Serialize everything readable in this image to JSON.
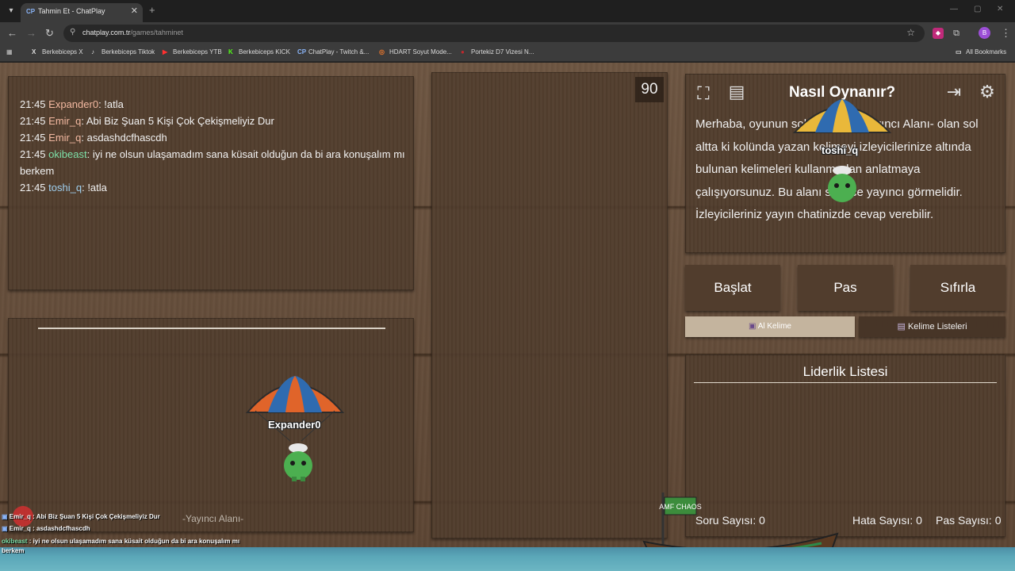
{
  "browser": {
    "tab_title": "Tahmin Et - ChatPlay",
    "tab_favicon": "CP",
    "url_host": "chatplay.com.tr",
    "url_path": "/games/tahminet",
    "profile_initial": "B"
  },
  "bookmarks": [
    {
      "icon": "X",
      "label": "Berkebiceps X",
      "color": "#ffffff"
    },
    {
      "icon": "♪",
      "label": "Berkebiceps Tiktok",
      "color": "#ffffff"
    },
    {
      "icon": "▶",
      "label": "Berkebiceps YTB",
      "color": "#ff3030"
    },
    {
      "icon": "K",
      "label": "Berkebiceps KICK",
      "color": "#53fc18"
    },
    {
      "icon": "CP",
      "label": "ChatPlay - Twitch &...",
      "color": "#8ab4f8"
    },
    {
      "icon": "◎",
      "label": "HDART Soyut Mode...",
      "color": "#e8762c"
    },
    {
      "icon": "●",
      "label": "Portekiz D7 Vizesi N...",
      "color": "#c0282d"
    }
  ],
  "all_bookmarks_label": "All Bookmarks",
  "chat": [
    {
      "time": "21:45",
      "user": "Expander0",
      "user_color": "#f2b8a0",
      "message": ": !atla"
    },
    {
      "time": "21:45",
      "user": "Emir_q",
      "user_color": "#f2b8a0",
      "message": ": Abi Biz Şuan 5 Kişi Çok Çekişmeliyiz Dur"
    },
    {
      "time": "21:45",
      "user": "Emir_q",
      "user_color": "#f2b8a0",
      "message": ": asdashdcfhascdh"
    },
    {
      "time": "21:45",
      "user": "okibeast",
      "user_color": "#7de0a8",
      "message": ": iyi ne olsun ulaşamadım sana küsait olduğun da bi ara konuşalım mı berkem"
    },
    {
      "time": "21:45",
      "user": "toshi_q",
      "user_color": "#9fd0f0",
      "message": ": !atla"
    }
  ],
  "timer": "90",
  "help": {
    "title": "Nasıl Oynanır?",
    "text": "Merhaba, oyunun sol altındaki -Yayıncı Alanı- olan sol altta ki kolünda yazan kelimeyi izleyicilerinize altında bulunan kelimeleri kullanmadan anlatmaya çalışıyorsunuz. Bu alanı sadece yayıncı görmelidir. İzleyicileriniz yayın chatinizde cevap verebilir."
  },
  "buttons": {
    "start": "Başlat",
    "pass": "Pas",
    "reset": "Sıfırla",
    "get_word": "Al Kelime",
    "word_lists": "Kelime Listeleri"
  },
  "leaderboard": {
    "title": "Liderlik Listesi"
  },
  "stats": {
    "questions": "Soru Sayısı: 0",
    "errors": "Hata Sayısı: 0",
    "passes": "Pas Sayısı: 0"
  },
  "streamer_area_label": "-Yayıncı Alanı-",
  "players": {
    "p1": "Expander0",
    "p2": "toshi_q"
  },
  "overlay_chat": [
    {
      "user": "Emir_q",
      "user_color": "#ffffff",
      "message": " : Abi Biz Şuan 5 Kişi Çok Çekişmeliyiz Dur"
    },
    {
      "user": "Emir_q",
      "user_color": "#ffffff",
      "message": " : asdashdcfhascdh"
    },
    {
      "user": "okibeast",
      "user_color": "#7de0a8",
      "message": " : iyi ne olsun ulaşamadım sana küsait olduğun da bi ara konuşalım mı"
    },
    {
      "user": "",
      "user_color": "#ffffff",
      "message": "berkem"
    }
  ],
  "boat_sign": "AMF CHAOS"
}
